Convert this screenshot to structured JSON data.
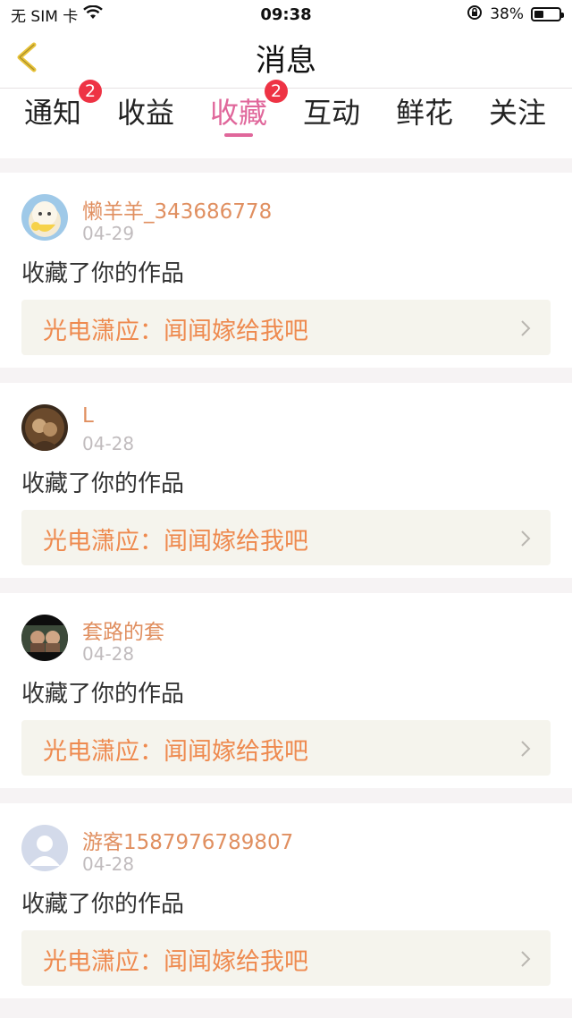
{
  "status_bar": {
    "carrier": "无 SIM 卡",
    "time": "09:38",
    "battery_percent": "38%",
    "battery_level": 0.38,
    "icons": [
      "wifi-icon",
      "rotation-lock-icon",
      "battery-icon"
    ]
  },
  "navbar": {
    "title": "消息",
    "back_icon": "chevron-left-icon",
    "accent_color": "#e8c33a"
  },
  "tabs": [
    {
      "label": "通知",
      "badge": "2",
      "active": false
    },
    {
      "label": "收益",
      "badge": null,
      "active": false
    },
    {
      "label": "收藏",
      "badge": "2",
      "active": true
    },
    {
      "label": "互动",
      "badge": null,
      "active": false
    },
    {
      "label": "鲜花",
      "badge": null,
      "active": false
    },
    {
      "label": "关注",
      "badge": null,
      "active": false
    }
  ],
  "colors": {
    "active_tab": "#e0679b",
    "username": "#e08f60",
    "work_link": "#ee8a4f",
    "badge": "#ee3344"
  },
  "messages": [
    {
      "username": "懒羊羊_343686778",
      "date": "04-29",
      "action": "收藏了你的作品",
      "work": "光电潇应：闻闻嫁给我吧",
      "avatar": "cartoon-avatar"
    },
    {
      "username": "L",
      "date": "04-28",
      "action": "收藏了你的作品",
      "work": "光电潇应：闻闻嫁给我吧",
      "avatar": "photo-avatar"
    },
    {
      "username": "套路的套",
      "date": "04-28",
      "action": "收藏了你的作品",
      "work": "光电潇应：闻闻嫁给我吧",
      "avatar": "photo-avatar"
    },
    {
      "username": "游客1587976789807",
      "date": "04-28",
      "action": "收藏了你的作品",
      "work": "光电潇应：闻闻嫁给我吧",
      "avatar": "default-user-avatar"
    }
  ]
}
